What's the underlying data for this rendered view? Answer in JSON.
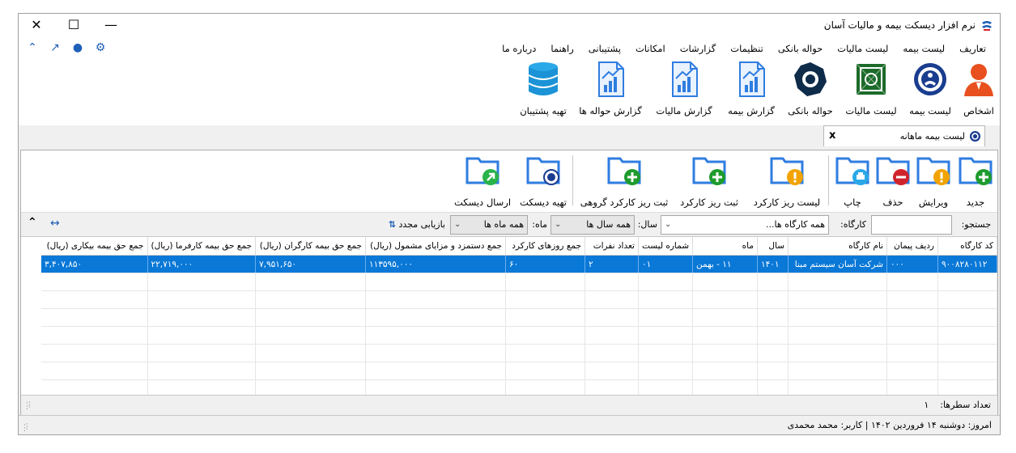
{
  "window": {
    "title": "نرم افزار دیسکت بیمه و مالیات آسان",
    "minimize": "—",
    "maximize": "☐",
    "close": "✕"
  },
  "menu": [
    "تعاریف",
    "لیست بیمه",
    "لیست مالیات",
    "حواله بانکی",
    "تنظیمات",
    "گزارشات",
    "امکانات",
    "پشتیبانی",
    "راهنما",
    "درباره ما"
  ],
  "ribbon": [
    {
      "label": "اشخاص",
      "icon": "person-icon"
    },
    {
      "label": "لیست بیمه",
      "icon": "insurance-logo-icon"
    },
    {
      "label": "لیست مالیات",
      "icon": "tax-logo-icon"
    },
    {
      "label": "حواله بانکی",
      "icon": "bank-logo-icon"
    },
    {
      "label": "گزارش بیمه",
      "icon": "report-chart-icon"
    },
    {
      "label": "گزارش مالیات",
      "icon": "report-chart-icon"
    },
    {
      "label": "گزارش حواله ها",
      "icon": "report-chart-icon"
    },
    {
      "label": "تهیه پشتیبان",
      "icon": "database-icon"
    }
  ],
  "tab": {
    "label": "لیست بیمه ماهانه",
    "close": "x"
  },
  "toolbar": {
    "new": "جدید",
    "edit": "ویرایش",
    "delete": "حذف",
    "print": "چاپ",
    "work_list": "لیست ریز کارکرد",
    "register_work": "ثبت ریز کارکرد",
    "register_group": "ثبت ریز کارکرد گروهی",
    "prepare_disk": "تهیه دیسکت",
    "send_disk": "ارسال دیسکت"
  },
  "filters": {
    "search_label": "جستجو:",
    "search_value": "",
    "workshop_label": "کارگاه:",
    "workshop_value": "همه کارگاه ها...",
    "year_label": "سال:",
    "year_value": "همه سال ها",
    "month_label": "ماه:",
    "month_value": "همه ماه ها",
    "refresh": "بازیابی مجدد"
  },
  "table": {
    "headers": [
      "کد کارگاه",
      "ردیف پیمان",
      "نام کارگاه",
      "سال",
      "ماه",
      "شماره لیست",
      "تعداد نفرات",
      "جمع روزهای کارکرد",
      "جمع دستمزد و مزایای مشمول (ریال)",
      "جمع حق بیمه کارگران (ریال)",
      "جمع حق بیمه کارفرما (ریال)",
      "جمع حق بیمه بیکاری (ریال)"
    ],
    "rows": [
      [
        "۹۰۰۸۲۸۰۱۱۲",
        "۰۰۰",
        "شرکت آسان سیستم مبنا",
        "۱۴۰۱",
        "۱۱ - بهمن",
        "۰۱",
        "۲",
        "۶۰",
        "۱۱۳۵۹۵,۰۰۰",
        "۷,۹۵۱,۶۵۰",
        "۲۲,۷۱۹,۰۰۰",
        "۳,۴۰۷,۸۵۰"
      ]
    ]
  },
  "footer": {
    "row_count_label": "تعداد سطرها:",
    "row_count": "۱"
  },
  "status": {
    "text": "امروز: دوشنبه ۱۴ فروردین ۱۴۰۲   |   کاربر: محمد محمدی"
  },
  "colors": {
    "accent": "#0a78d7",
    "folder": "#2f7de1",
    "green": "#1e9b2d",
    "red": "#d0242c",
    "orange": "#f2a300"
  }
}
